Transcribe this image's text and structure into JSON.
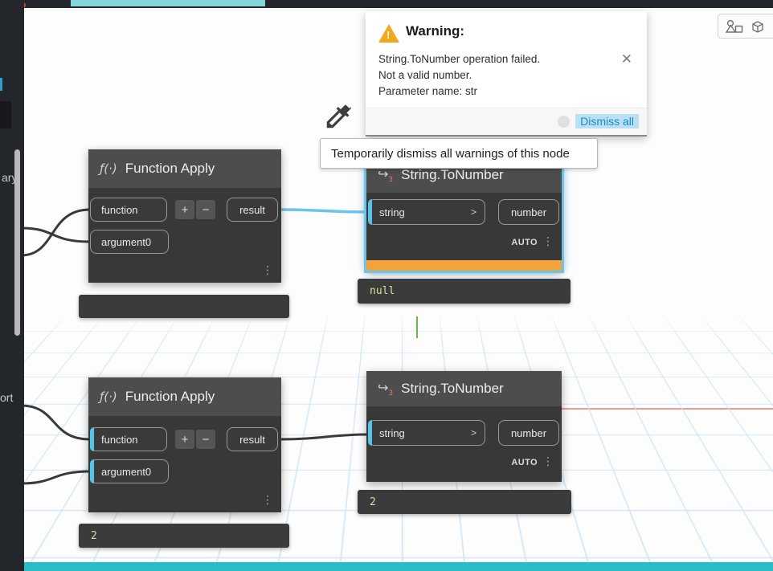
{
  "colors": {
    "selection": "#6fc3ea",
    "warning_bar": "#f2a33c",
    "link": "#1e88c7",
    "progress": "#85d6dc",
    "status_bar": "#2abcc4",
    "grid": "#cde4f6",
    "node_body": "#383838",
    "node_header": "#4d4d4d"
  },
  "sidebar": {
    "library_fragment": "ary",
    "import_fragment": "ort"
  },
  "warning_popup": {
    "title": "Warning:",
    "line1": "String.ToNumber operation failed.",
    "line2": "Not a valid number.",
    "line3": "Parameter name: str",
    "dismiss_all": "Dismiss all"
  },
  "tooltip": {
    "text": "Temporarily dismiss all warnings of this node"
  },
  "icons": {
    "warning_mark": "!",
    "close": "✕",
    "kebab": "⋮",
    "default_chevron": ">",
    "add": "+",
    "remove": "−",
    "function_apply": "ƒ(·)",
    "tonumber_arrow": "↪",
    "tonumber_index": "3"
  },
  "nodes": {
    "fa_top": {
      "title": "Function Apply",
      "in1": "function",
      "in2": "argument0",
      "out": "result",
      "preview": ""
    },
    "stn_top": {
      "title": "String.ToNumber",
      "in1": "string",
      "out": "number",
      "lacing": "AUTO",
      "preview": "null"
    },
    "fa_bottom": {
      "title": "Function Apply",
      "in1": "function",
      "in2": "argument0",
      "out": "result",
      "preview": "2"
    },
    "stn_bottom": {
      "title": "String.ToNumber",
      "in1": "string",
      "out": "number",
      "lacing": "AUTO",
      "preview": "2"
    }
  }
}
